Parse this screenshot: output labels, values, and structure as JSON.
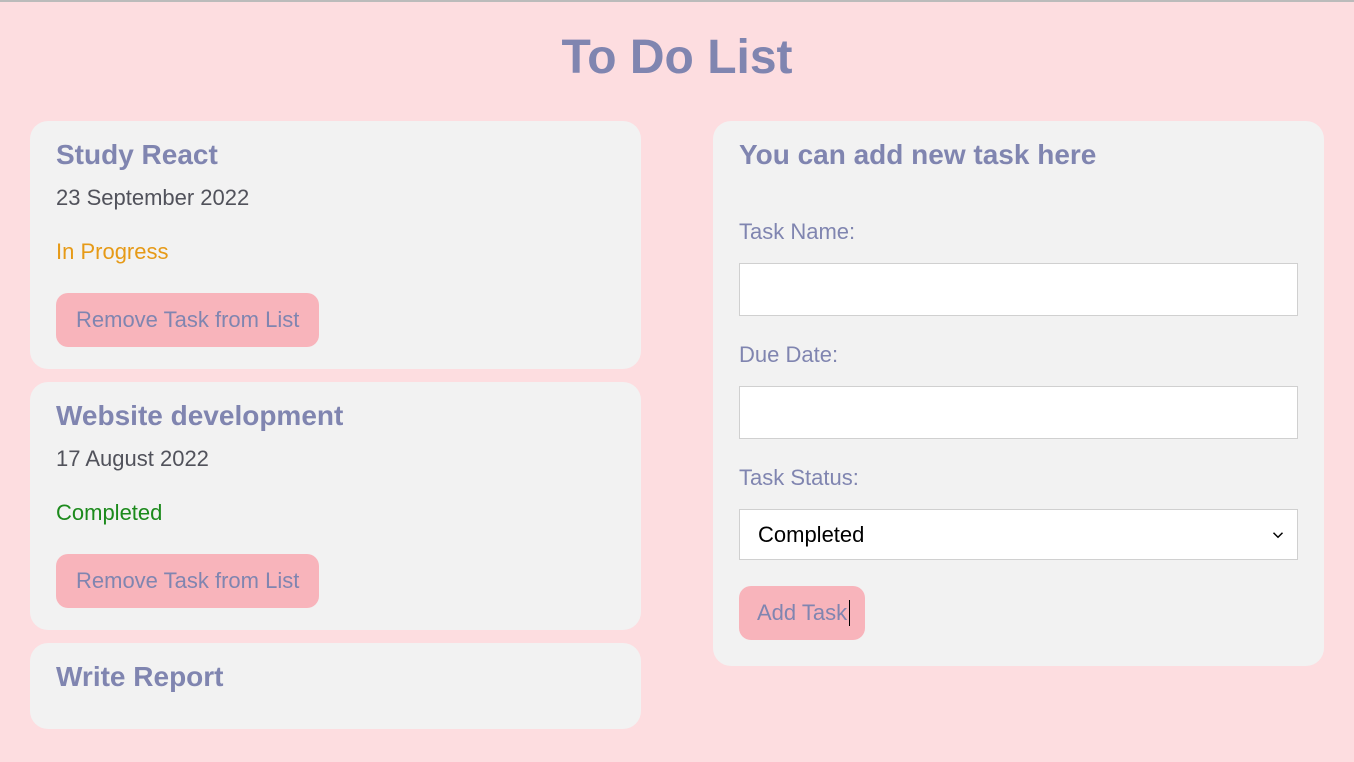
{
  "page": {
    "title": "To Do List"
  },
  "tasks": [
    {
      "name": "Study React",
      "date": "23 September 2022",
      "status": "In Progress",
      "statusClass": "status-in-progress"
    },
    {
      "name": "Website development",
      "date": "17 August 2022",
      "status": "Completed",
      "statusClass": "status-completed"
    },
    {
      "name": "Write Report"
    }
  ],
  "buttons": {
    "remove": "Remove Task from List",
    "add": "Add Task"
  },
  "form": {
    "title": "You can add new task here",
    "labels": {
      "taskName": "Task Name:",
      "dueDate": "Due Date:",
      "taskStatus": "Task Status:"
    },
    "values": {
      "taskName": "",
      "dueDate": "",
      "taskStatus": "Completed"
    },
    "statusOptions": [
      "Completed"
    ]
  }
}
